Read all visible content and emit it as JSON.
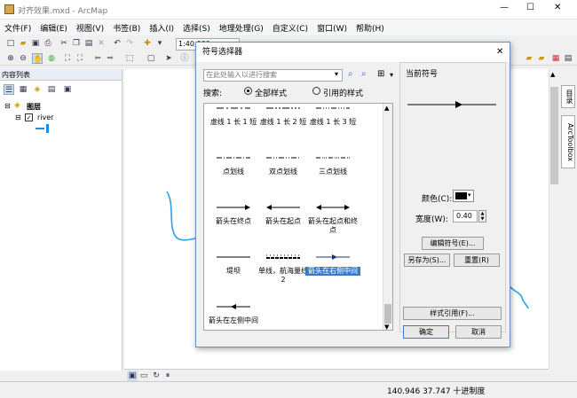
{
  "window": {
    "title": "对齐效果.mxd - ArcMap",
    "min": "—",
    "max": "☐",
    "close": "✕"
  },
  "menu": [
    "文件(F)",
    "编辑(E)",
    "视图(V)",
    "书签(B)",
    "插入(I)",
    "选择(S)",
    "地理处理(G)",
    "自定义(C)",
    "窗口(W)",
    "帮助(H)"
  ],
  "toolbar": {
    "scale": "1:40,000"
  },
  "toc": {
    "title": "内容列表",
    "layers_group": "图层",
    "layer": "river"
  },
  "right_tabs": [
    "目录",
    "ArcToolbox"
  ],
  "status": {
    "coords": "140.946  37.747 十进制度"
  },
  "dialog": {
    "title": "符号选择器",
    "close": "✕",
    "search_placeholder": "在此处输入以进行搜索",
    "search_label": "搜索:",
    "radio_all": "全部样式",
    "radio_ref": "引用的样式",
    "current_symbol": "当前符号",
    "color_label": "颜色(C):",
    "width_label": "宽度(W):",
    "width_value": "0.40",
    "edit_symbol": "编辑符号(E)...",
    "save_as": "另存为(S)...",
    "reset": "重置(R)",
    "style_ref": "样式引用(F)...",
    "ok": "确定",
    "cancel": "取消",
    "symbols": [
      {
        "label": "虚线 1 长 1 短",
        "glyph": "dash11"
      },
      {
        "label": "虚线 1 长 2 短",
        "glyph": "dash12"
      },
      {
        "label": "虚线 1 长 3 短",
        "glyph": "dash13"
      },
      {
        "label": "点划线",
        "glyph": "dashdot"
      },
      {
        "label": "双点划线",
        "glyph": "dash2dot"
      },
      {
        "label": "三点划线",
        "glyph": "dash3dot"
      },
      {
        "label": "箭头在终点",
        "glyph": "arrow-end"
      },
      {
        "label": "箭头在起点",
        "glyph": "arrow-start"
      },
      {
        "label": "箭头在起点和终点",
        "glyph": "arrow-both"
      },
      {
        "label": "堤坝",
        "glyph": "line"
      },
      {
        "label": "单线，航海量线 2",
        "glyph": "nautical"
      },
      {
        "label": "箭头在右侧中间",
        "glyph": "arrow-mid-right",
        "selected": true
      },
      {
        "label": "箭头在左侧中间",
        "glyph": "arrow-mid-left"
      }
    ]
  }
}
